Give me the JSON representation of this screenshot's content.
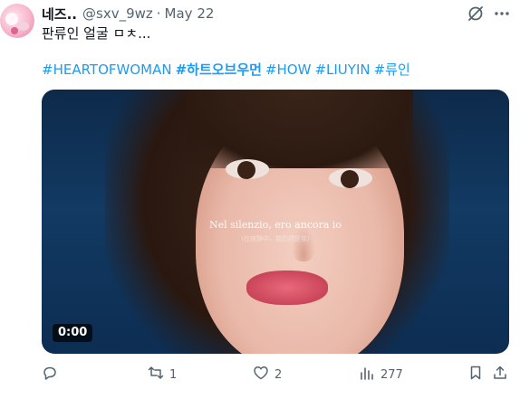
{
  "tweet": {
    "author_name": "네즈..",
    "handle": "@sxv_9wz",
    "separator": "·",
    "date": "May 22",
    "text": "판류인 얼굴 ㅁㅊ...",
    "hashtags": [
      "#HEARTOFWOMAN",
      "#하트오브우먼",
      "#HOW",
      "#LIUYIN",
      "#류인"
    ],
    "video": {
      "subtitle": "Nel silenzio, ero ancora io",
      "subtitle_small": "(在寂静中，我仍然是我)",
      "time": "0:00"
    },
    "actions": {
      "replies": "",
      "retweets": "1",
      "likes": "2",
      "views": "277"
    }
  },
  "icons": {
    "reply": "reply-icon",
    "retweet": "retweet-icon",
    "like": "heart-icon",
    "views": "views-icon",
    "bookmark": "bookmark-icon",
    "share": "share-icon",
    "grok": "grok-icon",
    "more": "more-icon"
  },
  "colors": {
    "link": "#1d9bf0",
    "muted": "#536471",
    "text": "#0f1419"
  }
}
